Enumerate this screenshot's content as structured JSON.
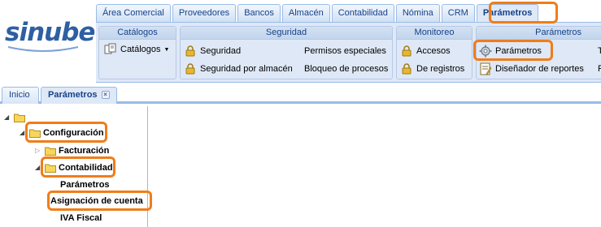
{
  "logo": {
    "text": "sinube"
  },
  "top_tabs": [
    {
      "label": "Área Comercial"
    },
    {
      "label": "Proveedores"
    },
    {
      "label": "Bancos"
    },
    {
      "label": "Almacén"
    },
    {
      "label": "Contabilidad"
    },
    {
      "label": "Nómina"
    },
    {
      "label": "CRM"
    },
    {
      "label": "Parámetros"
    }
  ],
  "ribbon": {
    "catalogos": {
      "title": "Catálogos",
      "item": "Catálogos"
    },
    "seguridad": {
      "title": "Seguridad",
      "items": [
        "Seguridad",
        "Seguridad por almacén",
        "Permisos especiales",
        "Bloqueo de procesos"
      ]
    },
    "monitoreo": {
      "title": "Monitoreo",
      "items": [
        "Accesos",
        "De registros"
      ]
    },
    "parametros": {
      "title": "Parámetros",
      "items": [
        "Parámetros",
        "Diseñador de reportes"
      ],
      "overflow_1": "T",
      "overflow_2": "F"
    }
  },
  "lower_tabs": [
    {
      "label": "Inicio"
    },
    {
      "label": "Parámetros",
      "close": "×"
    }
  ],
  "tree": {
    "configuracion": "Configuración",
    "facturacion": "Facturación",
    "contabilidad": "Contabilidad",
    "parametros": "Parámetros",
    "asignacion": "Asignación de cuenta",
    "iva": "IVA Fiscal"
  },
  "colors": {
    "accent": "#f07d19",
    "brand": "#2e5fa3",
    "tab_border": "#99bbe8",
    "ribbon_bg": "#dfe8f6"
  }
}
